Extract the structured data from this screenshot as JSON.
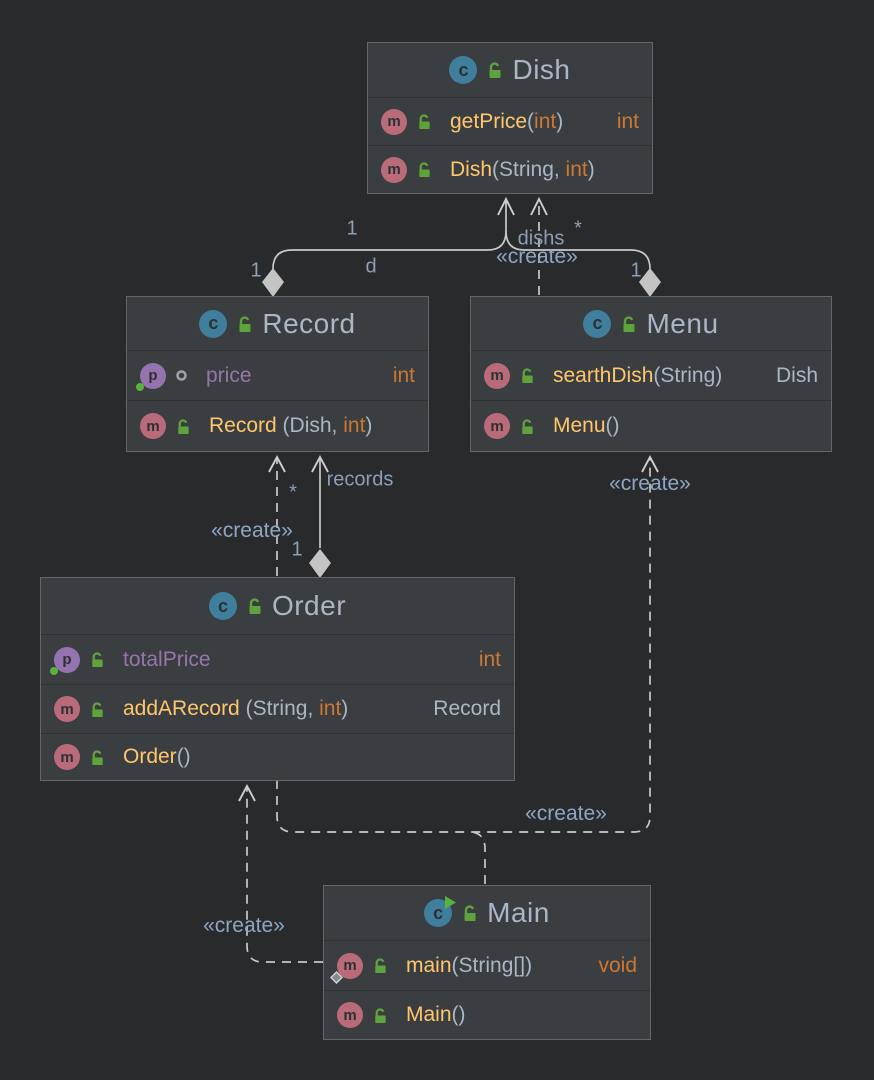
{
  "diagram": {
    "kind": "uml-class-diagram",
    "background": "#282a2c",
    "box_fill": "#3b3e41",
    "box_border": "#63666a",
    "edge_color": "#c9c9c9",
    "label_color": "#8d9fb5",
    "colors": {
      "class_name": "#a9b7c6",
      "method_name": "#ffc66d",
      "field_name": "#9876aa",
      "primitive_type": "#cc7832",
      "reference_type": "#a9b7c6",
      "class_icon": "#3f7e9c",
      "method_icon": "#b96b7a",
      "property_icon": "#9473ae",
      "lock_icon": "#5fa33d"
    }
  },
  "icons": {
    "class_letter": "c",
    "method_letter": "m",
    "property_letter": "p"
  },
  "classes": [
    {
      "name": "Dish",
      "members": [
        {
          "segments": [
            {
              "t": "getPrice",
              "c": "m"
            },
            {
              "t": "(",
              "c": "p"
            },
            {
              "t": "int",
              "c": "i"
            },
            {
              "t": ")",
              "c": "p"
            }
          ],
          "rtype": "int"
        },
        {
          "segments": [
            {
              "t": "Dish",
              "c": "m"
            },
            {
              "t": "(",
              "c": "p"
            },
            {
              "t": "String",
              "c": "p"
            },
            {
              "t": ", ",
              "c": "p"
            },
            {
              "t": "int",
              "c": "i"
            },
            {
              "t": ")",
              "c": "p"
            }
          ],
          "rtype": ""
        }
      ]
    },
    {
      "name": "Record",
      "members": [
        {
          "segments": [
            {
              "t": "price",
              "c": "f"
            }
          ],
          "rtype": "int"
        },
        {
          "segments": [
            {
              "t": "Record ",
              "c": "m"
            },
            {
              "t": "(",
              "c": "p"
            },
            {
              "t": "Dish",
              "c": "p"
            },
            {
              "t": ", ",
              "c": "p"
            },
            {
              "t": "int",
              "c": "i"
            },
            {
              "t": ")",
              "c": "p"
            }
          ],
          "rtype": ""
        }
      ]
    },
    {
      "name": "Menu",
      "members": [
        {
          "segments": [
            {
              "t": "searthDish",
              "c": "m"
            },
            {
              "t": "(",
              "c": "p"
            },
            {
              "t": "String",
              "c": "p"
            },
            {
              "t": ")",
              "c": "p"
            }
          ],
          "rtype": "Dish"
        },
        {
          "segments": [
            {
              "t": "Menu",
              "c": "m"
            },
            {
              "t": "()",
              "c": "p"
            }
          ],
          "rtype": ""
        }
      ]
    },
    {
      "name": "Order",
      "members": [
        {
          "segments": [
            {
              "t": "totalPrice",
              "c": "f"
            }
          ],
          "rtype": "int"
        },
        {
          "segments": [
            {
              "t": "addARecord ",
              "c": "m"
            },
            {
              "t": "(",
              "c": "p"
            },
            {
              "t": "String",
              "c": "p"
            },
            {
              "t": ", ",
              "c": "p"
            },
            {
              "t": "int",
              "c": "i"
            },
            {
              "t": ")",
              "c": "p"
            }
          ],
          "rtype": "Record"
        },
        {
          "segments": [
            {
              "t": "Order",
              "c": "m"
            },
            {
              "t": "()",
              "c": "p"
            }
          ],
          "rtype": ""
        }
      ]
    },
    {
      "name": "Main",
      "members": [
        {
          "segments": [
            {
              "t": "main",
              "c": "m"
            },
            {
              "t": "(",
              "c": "p"
            },
            {
              "t": "String[]",
              "c": "p"
            },
            {
              "t": ")",
              "c": "p"
            }
          ],
          "rtype": "void"
        },
        {
          "segments": [
            {
              "t": "Main",
              "c": "m"
            },
            {
              "t": "()",
              "c": "p"
            }
          ],
          "rtype": ""
        }
      ]
    }
  ],
  "relationships": [
    {
      "from": "Record",
      "to": "Dish",
      "type": "aggregation",
      "role": "d",
      "multiplicity_target": "1",
      "multiplicity_source": "1"
    },
    {
      "from": "Menu",
      "to": "Dish",
      "type": "aggregation",
      "role": "dishs",
      "multiplicity_target": "*",
      "multiplicity_source": "1"
    },
    {
      "from": "Menu",
      "to": "Dish",
      "type": "dependency",
      "stereotype": "«create»"
    },
    {
      "from": "Order",
      "to": "Record",
      "type": "aggregation",
      "role": "records",
      "multiplicity_target": "*",
      "multiplicity_source": "1"
    },
    {
      "from": "Order",
      "to": "Record",
      "type": "dependency",
      "stereotype": "«create»"
    },
    {
      "from": "Main",
      "to": "Order",
      "type": "dependency",
      "stereotype": "«create»"
    },
    {
      "from": "Main",
      "to": "Menu",
      "type": "dependency",
      "stereotype": "«create»"
    },
    {
      "from": "Order",
      "to": "Menu",
      "type": "dependency",
      "stereotype": "«create»"
    }
  ],
  "edge_labels": [
    {
      "text": "1"
    },
    {
      "text": "d"
    },
    {
      "text": "1"
    },
    {
      "text": "1"
    },
    {
      "text": "*"
    },
    {
      "text": "dishs"
    },
    {
      "text": "«create»"
    },
    {
      "text": "records"
    },
    {
      "text": "*"
    },
    {
      "text": "1"
    },
    {
      "text": "«create»"
    },
    {
      "text": "«create»"
    },
    {
      "text": "«create»"
    },
    {
      "text": "«create»"
    }
  ]
}
